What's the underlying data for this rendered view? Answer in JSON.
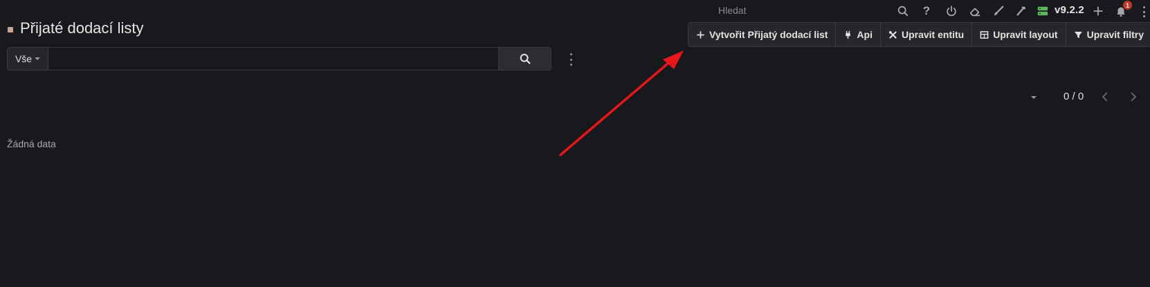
{
  "navbar": {
    "search_placeholder": "Hledat",
    "version": "v9.2.2",
    "notification_count": "1",
    "icons": [
      "search-icon",
      "help-icon",
      "power-icon",
      "eraser-icon",
      "brush-icon",
      "hammer-icon",
      "server-icon",
      "plus-icon",
      "bell-icon",
      "more-vertical-icon"
    ]
  },
  "page": {
    "title": "Přijaté dodací listy"
  },
  "search": {
    "filter_label": "Vše",
    "input_value": ""
  },
  "actions": {
    "create": "Vytvořit Přijatý dodací list",
    "api": "Api",
    "edit_entity": "Upravit entitu",
    "edit_layout": "Upravit layout",
    "edit_filters": "Upravit filtry"
  },
  "pager": {
    "count": "0 / 0"
  },
  "list": {
    "empty_text": "Žádná data"
  },
  "colors": {
    "background": "#18191c",
    "annotation_arrow": "#e8151b",
    "badge": "#c0392b",
    "server_icon": "#5cb85c"
  }
}
